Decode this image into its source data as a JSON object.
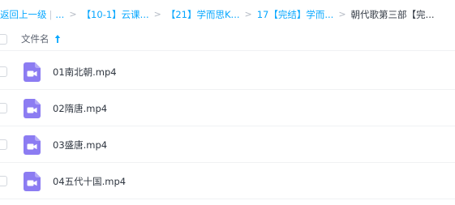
{
  "breadcrumb": {
    "back_label": "返回上一级",
    "pipe": "|",
    "ellipsis": "...",
    "separator": ">",
    "crumbs": [
      "【10-1】云课...",
      "【21】学而思K...",
      "17【完结】学而..."
    ],
    "current": "朝代歌第三部【完..."
  },
  "header": {
    "column_name": "文件名",
    "sort_direction": "ascending",
    "sort_icon": "arrow-up-icon"
  },
  "files": [
    {
      "name": "01南北朝.mp4",
      "icon": "video-file-icon"
    },
    {
      "name": "02隋唐.mp4",
      "icon": "video-file-icon"
    },
    {
      "name": "03盛唐.mp4",
      "icon": "video-file-icon"
    },
    {
      "name": "04五代十国.mp4",
      "icon": "video-file-icon"
    }
  ],
  "colors": {
    "link": "#06a7ff",
    "video_icon": "#8c7cf2",
    "text": "#2f3640"
  }
}
